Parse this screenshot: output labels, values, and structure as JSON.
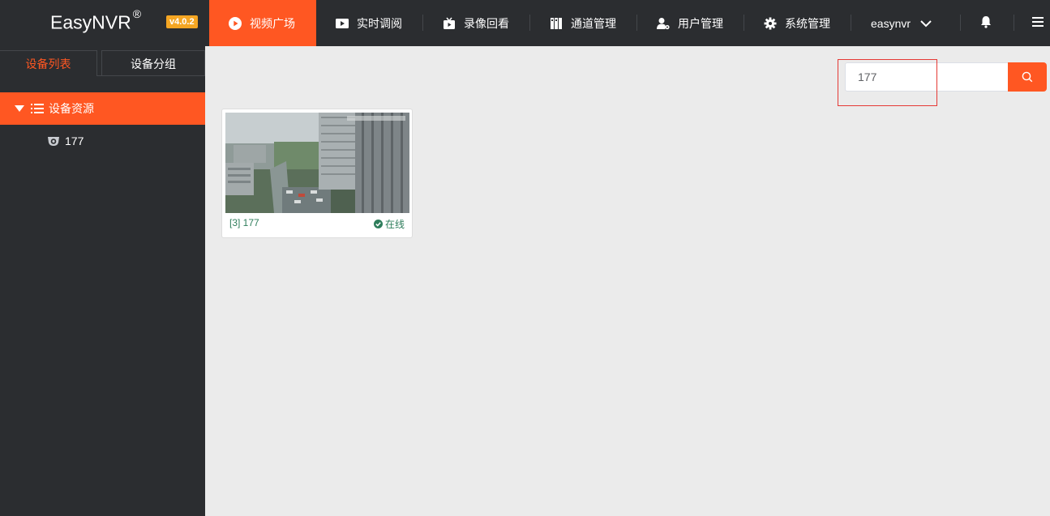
{
  "app": {
    "logo_text": "EasyNVR",
    "registered_mark": "®",
    "version": "v4.0.2"
  },
  "nav": {
    "items": [
      {
        "label": "视频广场",
        "icon": "play-circle-icon",
        "active": true
      },
      {
        "label": "实时调阅",
        "icon": "video-camera-icon",
        "active": false
      },
      {
        "label": "录像回看",
        "icon": "tv-icon",
        "active": false
      },
      {
        "label": "通道管理",
        "icon": "book-icon",
        "active": false
      },
      {
        "label": "用户管理",
        "icon": "user-gear-icon",
        "active": false
      },
      {
        "label": "系统管理",
        "icon": "gear-icon",
        "active": false
      }
    ],
    "username": "easynvr"
  },
  "sidebar": {
    "tabs": [
      {
        "label": "设备列表",
        "active": true
      },
      {
        "label": "设备分组",
        "active": false
      }
    ],
    "tree": {
      "root_label": "设备资源",
      "children": [
        {
          "label": "177",
          "icon": "camera-icon"
        }
      ]
    }
  },
  "search": {
    "value": "177",
    "icon": "search-icon"
  },
  "cards": [
    {
      "title": "[3] 177",
      "status": "在线",
      "status_icon": "check-circle-icon"
    }
  ],
  "colors": {
    "accent": "#ff5722",
    "topbar": "#2b2d30",
    "sidebar": "#2b2d30",
    "content_bg": "#ebebeb",
    "online": "#2e7d5b",
    "version_badge": "#f5a623",
    "highlight_box": "#e53935"
  }
}
